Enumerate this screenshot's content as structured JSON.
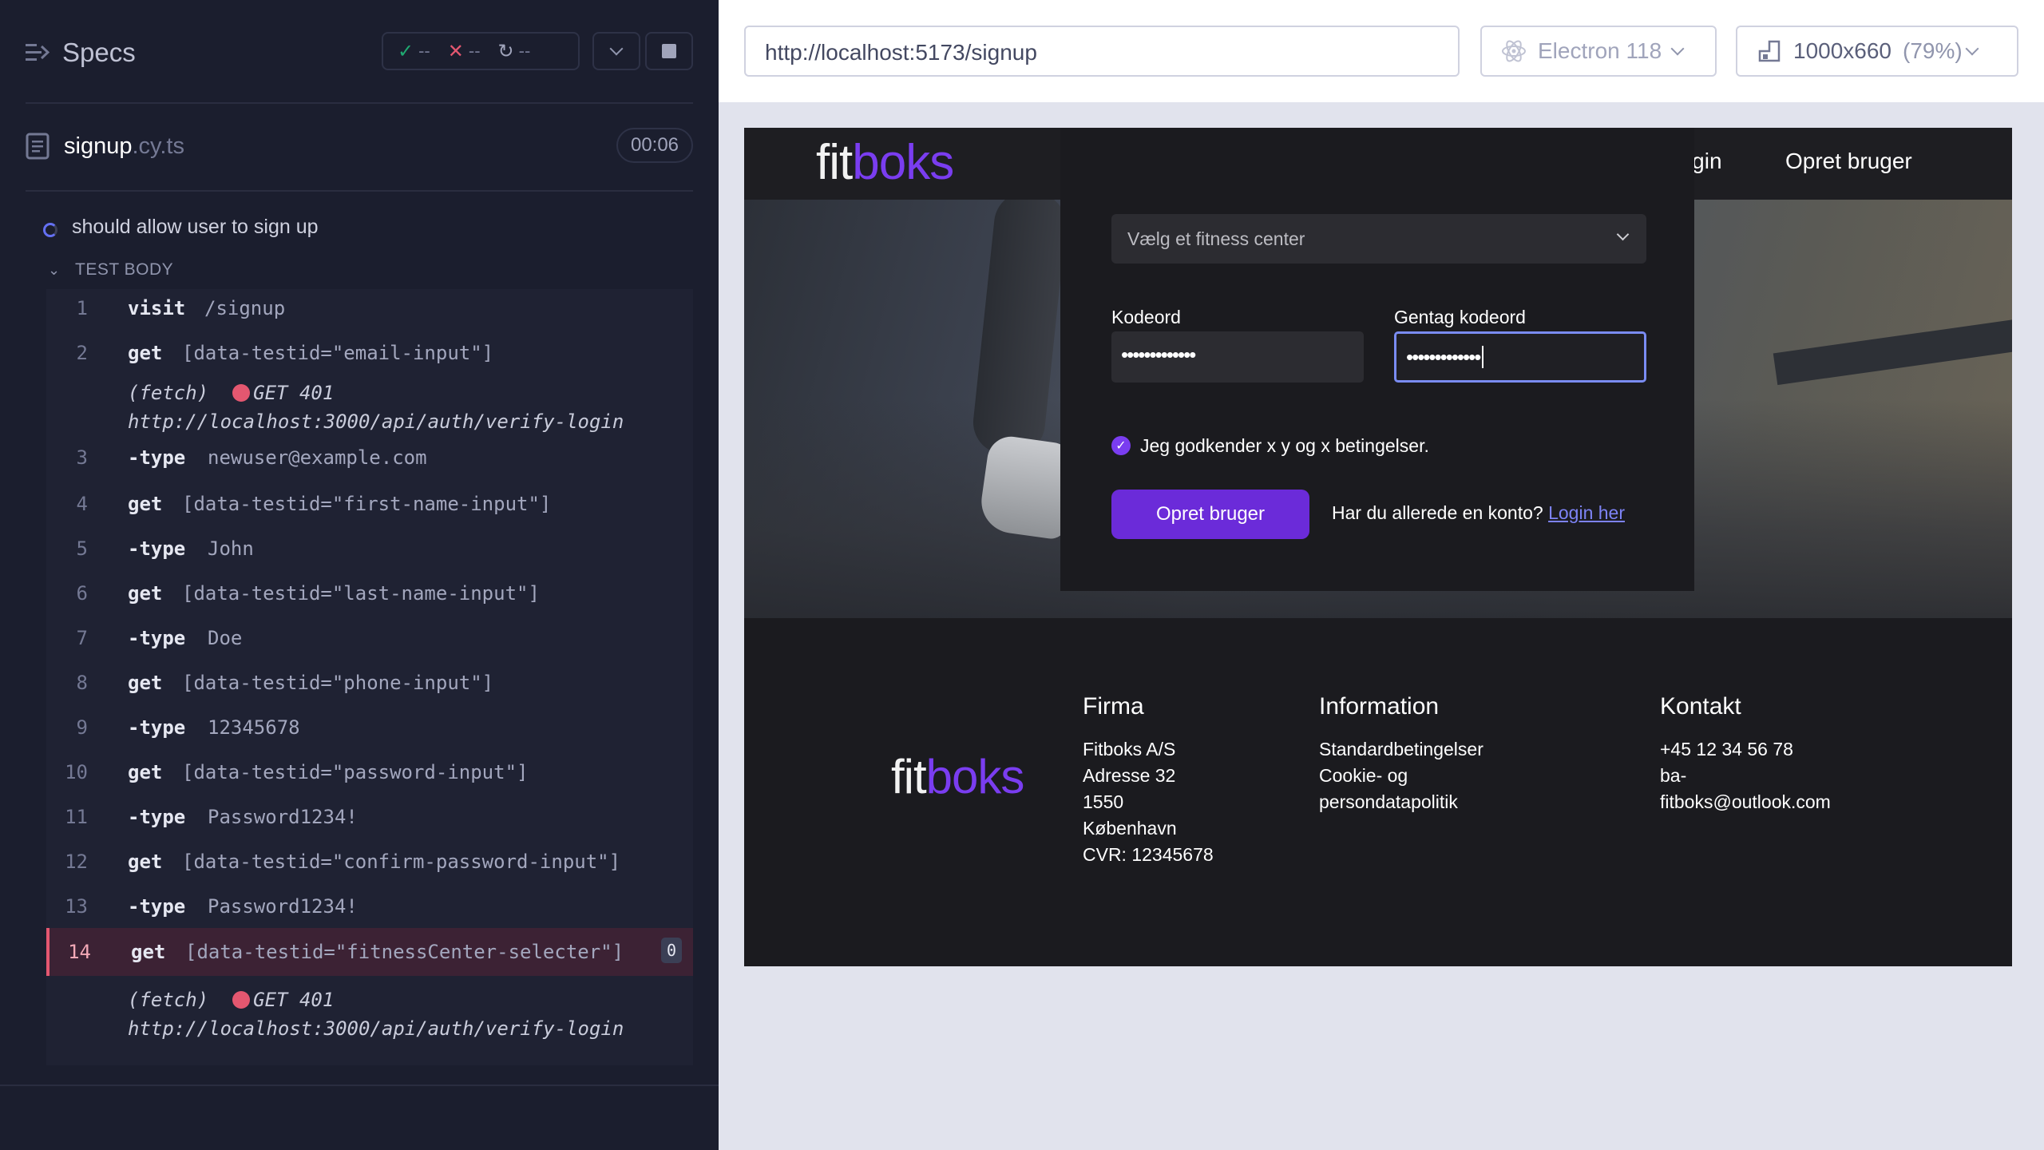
{
  "reporter": {
    "title": "Specs",
    "stats": {
      "passed": "--",
      "failed": "--",
      "pending": "--"
    },
    "spec": {
      "name": "signup",
      "ext": ".cy.ts",
      "time": "00:06"
    },
    "test_title": "should allow user to sign up",
    "test_body_label": "TEST BODY",
    "commands": [
      {
        "num": "1",
        "name": "visit",
        "msg": "/signup"
      },
      {
        "num": "2",
        "name": "get",
        "msg": "[data-testid=\"email-input\"]"
      },
      {
        "num": "",
        "fetch": true,
        "label": "(fetch)",
        "status": "GET 401",
        "url": "http://localhost:3000/api/auth/verify-login"
      },
      {
        "num": "3",
        "name": "-type",
        "msg": "newuser@example.com"
      },
      {
        "num": "4",
        "name": "get",
        "msg": "[data-testid=\"first-name-input\"]"
      },
      {
        "num": "5",
        "name": "-type",
        "msg": "John"
      },
      {
        "num": "6",
        "name": "get",
        "msg": "[data-testid=\"last-name-input\"]"
      },
      {
        "num": "7",
        "name": "-type",
        "msg": "Doe"
      },
      {
        "num": "8",
        "name": "get",
        "msg": "[data-testid=\"phone-input\"]"
      },
      {
        "num": "9",
        "name": "-type",
        "msg": "12345678"
      },
      {
        "num": "10",
        "name": "get",
        "msg": "[data-testid=\"password-input\"]"
      },
      {
        "num": "11",
        "name": "-type",
        "msg": "Password1234!"
      },
      {
        "num": "12",
        "name": "get",
        "msg": "[data-testid=\"confirm-password-input\"]"
      },
      {
        "num": "13",
        "name": "-type",
        "msg": "Password1234!"
      },
      {
        "num": "14",
        "name": "get",
        "msg": "[data-testid=\"fitnessCenter-selecter\"]",
        "badge": "0",
        "active": true
      },
      {
        "num": "",
        "fetch": true,
        "label": "(fetch)",
        "status": "GET 401",
        "url": "http://localhost:3000/api/auth/verify-login"
      }
    ]
  },
  "aut_bar": {
    "url": "http://localhost:5173/signup",
    "browser": "Electron 118",
    "viewport": "1000x660",
    "scale": "(79%)"
  },
  "app": {
    "logo_a": "fit",
    "logo_b": "boks",
    "nav": {
      "login": "Login",
      "signup": "Opret bruger"
    },
    "form": {
      "select_placeholder": "Vælg et fitness center",
      "password_label": "Kodeord",
      "password_value": "•••••••••••••",
      "confirm_label": "Gentag kodeord",
      "confirm_value": "•••••••••••••",
      "terms": "Jeg godkender x y og x betingelser.",
      "submit": "Opret bruger",
      "login_question": "Har du allerede en konto?",
      "login_link": "Login her"
    },
    "footer": {
      "firma_title": "Firma",
      "firma_lines": [
        "Fitboks A/S",
        "Adresse 32",
        "1550",
        "København",
        "CVR: 12345678"
      ],
      "info_title": "Information",
      "info_lines": [
        "Standardbetingelser",
        "Cookie- og",
        "persondatapolitik"
      ],
      "kontakt_title": "Kontakt",
      "kontakt_lines": [
        "+45 12 34 56 78",
        "ba-",
        "fitboks@outlook.com"
      ]
    }
  },
  "colors": {
    "brand": "#7a3df0",
    "error": "#e45770",
    "reporter_bg": "#1b1e2e"
  }
}
